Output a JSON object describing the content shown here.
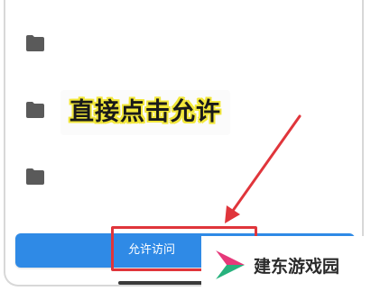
{
  "folders": [
    {
      "icon": "folder-icon"
    },
    {
      "icon": "folder-icon"
    },
    {
      "icon": "folder-icon"
    }
  ],
  "annotation": {
    "callout_text": "直接点击允许",
    "callout_text_color": "#1a1a1a",
    "callout_outline_color": "#f2e73a",
    "highlight_color": "#e0353b",
    "arrow_color": "#e0353b"
  },
  "action_button": {
    "label": "允许访问",
    "color": "#2f8ae6"
  },
  "watermark": {
    "text": "建东游戏园",
    "logo_colors": [
      "#e6397a",
      "#27b27d"
    ]
  }
}
